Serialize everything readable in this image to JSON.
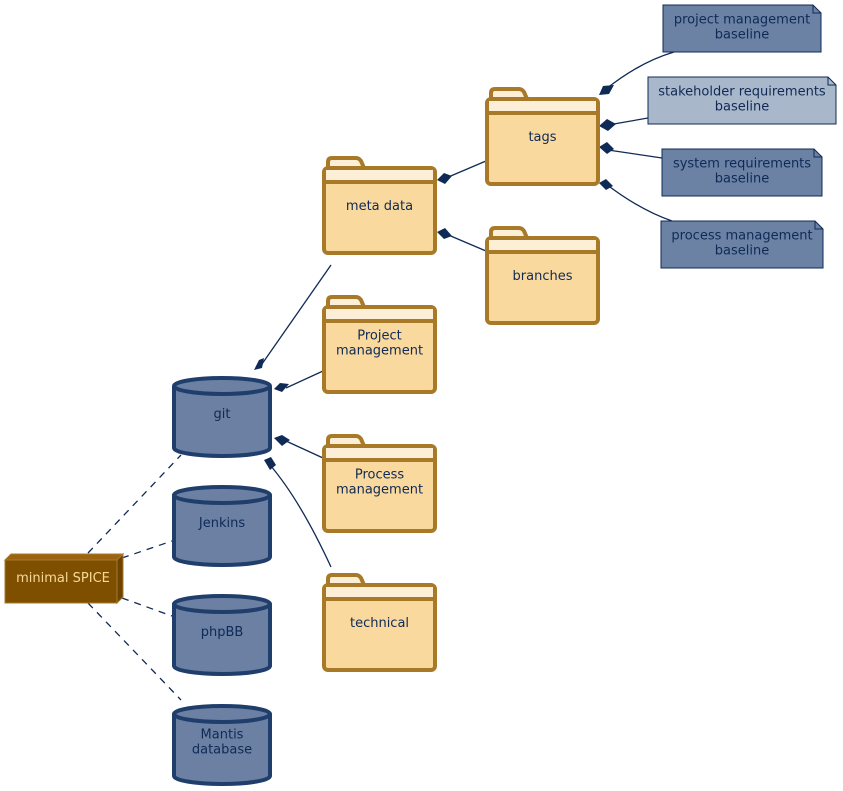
{
  "diagram": {
    "node": {
      "label": "minimal SPICE"
    },
    "databases": [
      {
        "id": "git",
        "lines": [
          "git"
        ]
      },
      {
        "id": "jenkins",
        "lines": [
          "Jenkins"
        ]
      },
      {
        "id": "phpbb",
        "lines": [
          "phpBB"
        ]
      },
      {
        "id": "mantis",
        "lines": [
          "Mantis",
          "database"
        ]
      }
    ],
    "folders": [
      {
        "id": "meta-data",
        "lines": [
          "meta data"
        ]
      },
      {
        "id": "project-management",
        "lines": [
          "Project",
          "management"
        ]
      },
      {
        "id": "process-management",
        "lines": [
          "Process",
          "management"
        ]
      },
      {
        "id": "technical",
        "lines": [
          "technical"
        ]
      },
      {
        "id": "tags",
        "lines": [
          "tags"
        ]
      },
      {
        "id": "branches",
        "lines": [
          "branches"
        ]
      }
    ],
    "notes": [
      {
        "id": "project-management-baseline",
        "lines": [
          "project management",
          "baseline"
        ],
        "highlight": false
      },
      {
        "id": "stakeholder-requirements-baseline",
        "lines": [
          "stakeholder requirements",
          "baseline"
        ],
        "highlight": true
      },
      {
        "id": "system-requirements-baseline",
        "lines": [
          "system requirements",
          "baseline"
        ],
        "highlight": false
      },
      {
        "id": "process-management-baseline",
        "lines": [
          "process management",
          "baseline"
        ],
        "highlight": false
      }
    ],
    "colors": {
      "node_fill": "#7f4f00",
      "node_stroke": "#a87a2c",
      "node_text": "#f7d99b",
      "db_fill": "#6b80a3",
      "db_stroke": "#203e6b",
      "folder_fill": "#f9d99e",
      "folder_tab": "#fdefd7",
      "folder_stroke": "#a87a28",
      "note_fill": "#6b82a5",
      "note_highlight_fill": "#a9b7cb",
      "note_stroke": "#0f2a55",
      "edge": "#0f2a55"
    }
  }
}
